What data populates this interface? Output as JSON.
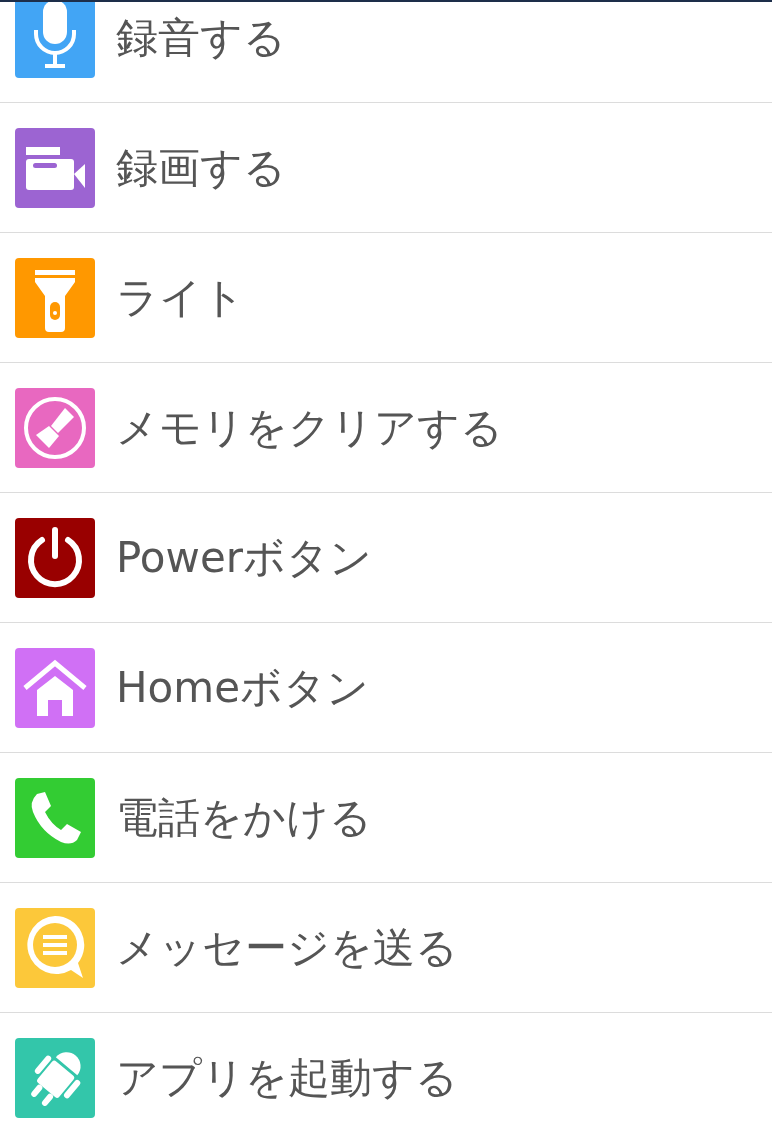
{
  "items": [
    {
      "label": "録音する",
      "kind": "mic",
      "color": "#42a5f5"
    },
    {
      "label": "録画する",
      "kind": "video",
      "color": "#9c64d2"
    },
    {
      "label": "ライト",
      "kind": "flashlight",
      "color": "#ff9800"
    },
    {
      "label": "メモリをクリアする",
      "kind": "brush",
      "color": "#e868c0"
    },
    {
      "label": "Powerボタン",
      "kind": "power",
      "color": "#990000"
    },
    {
      "label": "Homeボタン",
      "kind": "home",
      "color": "#d070f5"
    },
    {
      "label": "電話をかける",
      "kind": "phone",
      "color": "#33cc33"
    },
    {
      "label": "メッセージを送る",
      "kind": "message",
      "color": "#fcc83a"
    },
    {
      "label": "アプリを起動する",
      "kind": "android",
      "color": "#33c6aa"
    }
  ]
}
